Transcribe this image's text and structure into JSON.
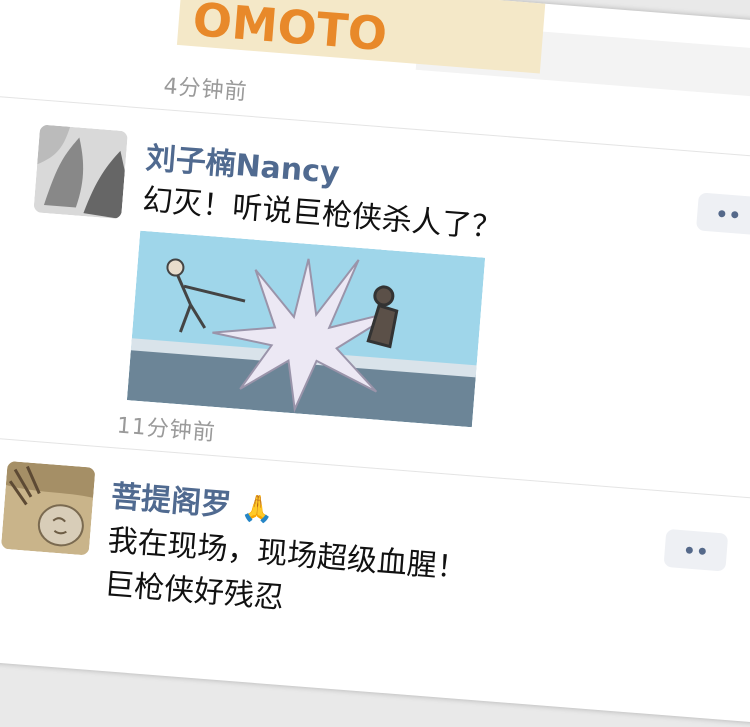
{
  "posts": [
    {
      "time": "4分钟前"
    },
    {
      "name": "刘子楠Nancy",
      "text": "幻灭！听说巨枪侠杀人了？",
      "time": "11分钟前"
    },
    {
      "name": "菩提阁罗",
      "emoji": "🙏",
      "text_line1": "我在现场，现场超级血腥！",
      "text_line2": "巨枪侠好残忍"
    }
  ],
  "top_image_text": "OMOTO",
  "icons": {
    "more": "more-dots-icon",
    "emoji": "folded-hands-icon"
  }
}
